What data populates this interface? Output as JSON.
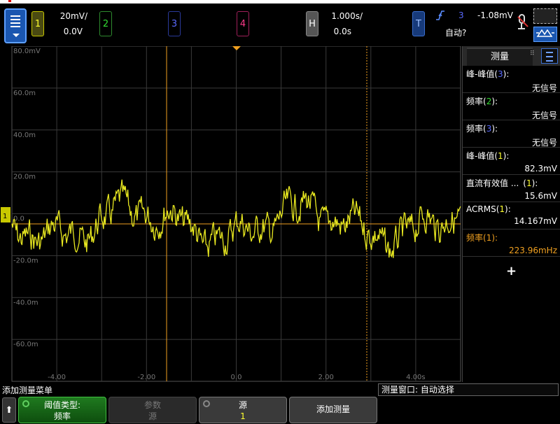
{
  "top_bar": {
    "ch1": {
      "label": "1",
      "scale": "20mV/",
      "offset": "0.0V",
      "color": "#ffff30"
    },
    "ch2": {
      "label": "2",
      "color": "#33dd33"
    },
    "ch3": {
      "label": "3",
      "color": "#5a6aff"
    },
    "ch4": {
      "label": "4",
      "color": "#ff3a8a"
    },
    "horizontal": {
      "label": "H",
      "scale": "1.000s/",
      "delay": "0.0s"
    },
    "trigger": {
      "label": "T",
      "slope_icon": "rising-edge-icon",
      "source": "3",
      "level": "-1.08mV",
      "mode": "自动?"
    }
  },
  "graticule": {
    "y_labels": [
      "80.0mV",
      "60.0m",
      "40.0m",
      "20.0m",
      "0.0",
      "-20.0m",
      "-40.0m",
      "-60.0m"
    ],
    "x_labels": [
      "-4.00",
      "-2.00",
      "0.0",
      "2.00",
      "4.00s"
    ],
    "ch1_marker": "1"
  },
  "measurements": {
    "title": "测量",
    "items": [
      {
        "name": "峰-峰值",
        "source": "3",
        "source_color": "#5a6aff",
        "value": "无信号"
      },
      {
        "name": "频率",
        "source": "2",
        "source_color": "#33dd33",
        "value": "无信号"
      },
      {
        "name": "频率",
        "source": "3",
        "source_color": "#5a6aff",
        "value": "无信号"
      },
      {
        "name": "峰-峰值",
        "source": "1",
        "source_color": "#ffff30",
        "value": "82.3mV"
      },
      {
        "name": "直流有效值 ...",
        "source": "1",
        "source_color": "#ffff30",
        "value": "15.6mV"
      },
      {
        "name": "ACRMS",
        "source": "1",
        "source_color": "#ffff30",
        "value": "14.167mV"
      },
      {
        "name": "频率",
        "source": "1",
        "source_color": "#f0a020",
        "value": "223.96mHz",
        "active": true
      }
    ],
    "add_symbol": "+"
  },
  "status": {
    "menu_title": "添加测量菜单",
    "meas_window": "测量窗口: 自动选择"
  },
  "softkeys": {
    "back": "⬆",
    "k1": {
      "top": "阈值类型:",
      "bottom": "频率"
    },
    "k2": {
      "top": "参数",
      "bottom": "源"
    },
    "k3": {
      "top": "源",
      "bottom": "1"
    },
    "k4": {
      "label": "添加测量"
    }
  }
}
